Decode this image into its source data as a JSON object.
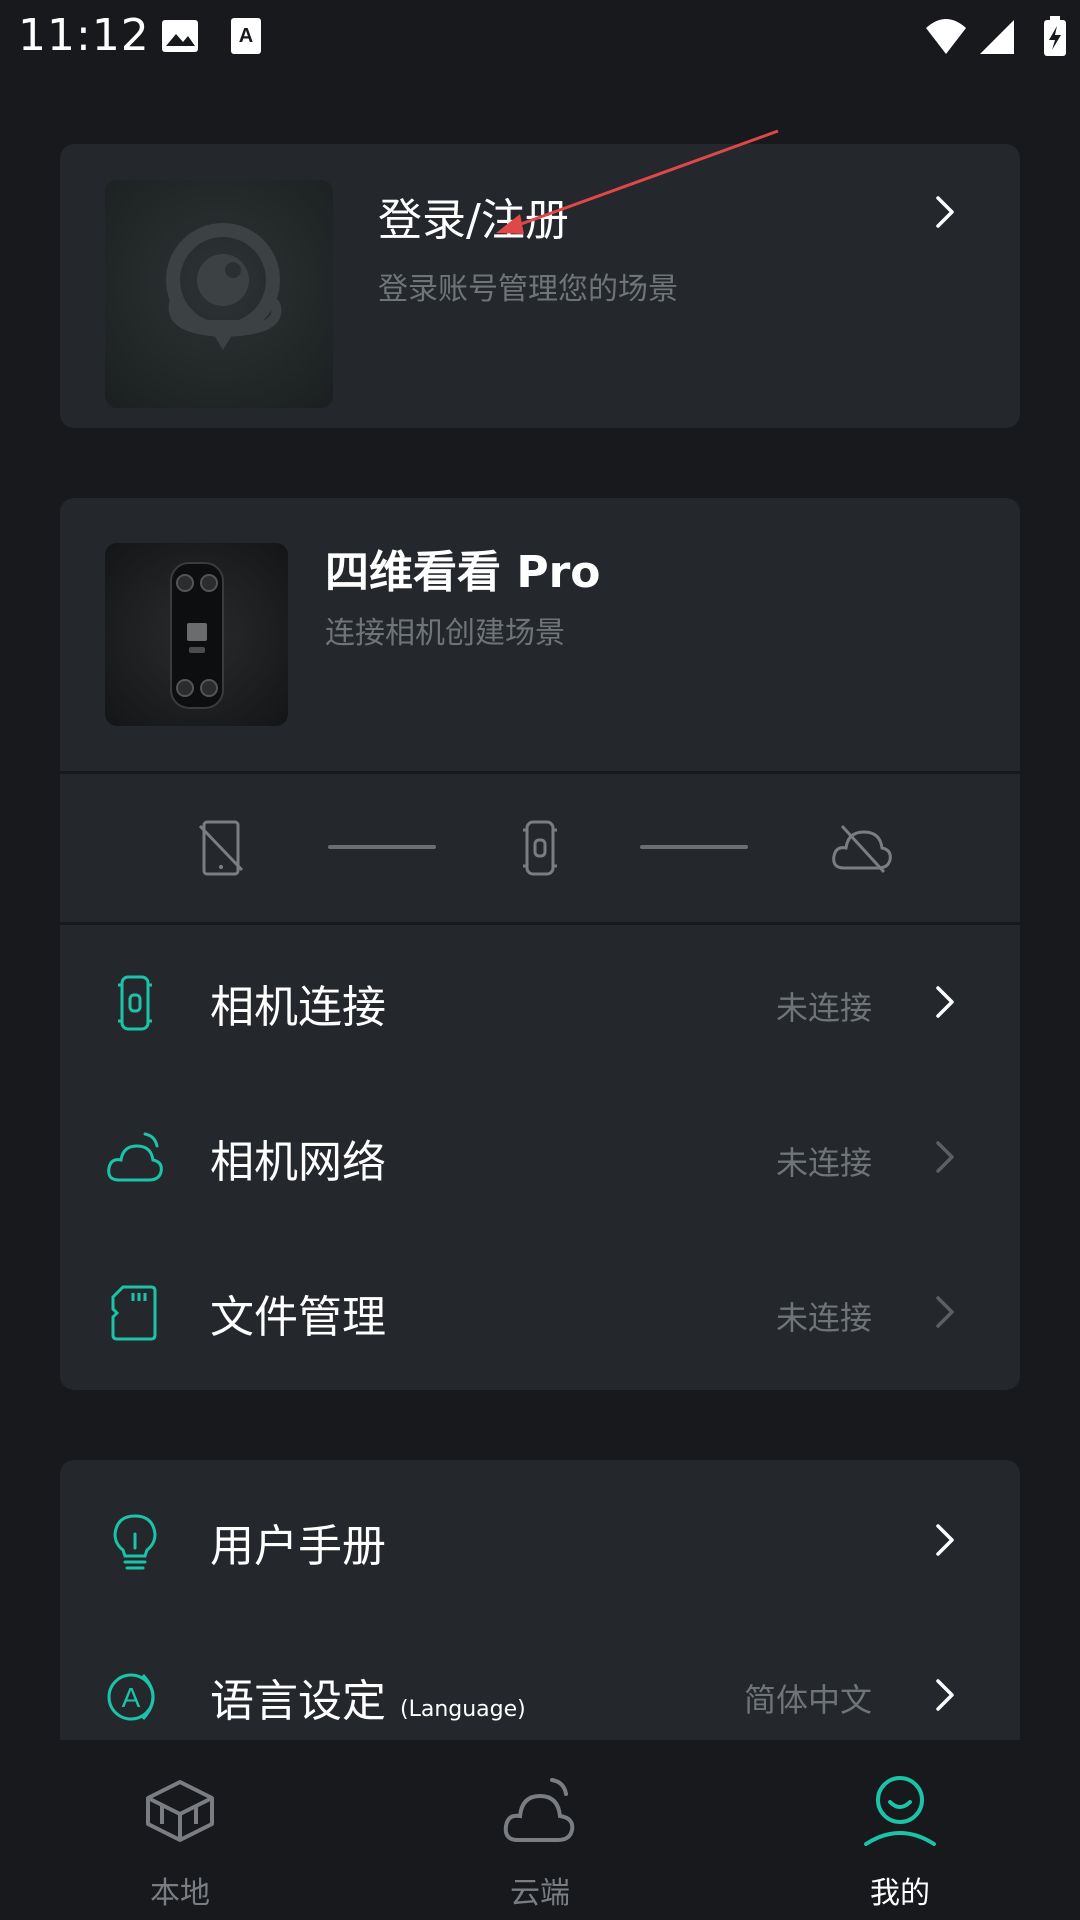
{
  "status_bar": {
    "time": "11:12"
  },
  "login": {
    "title": "登录/注册",
    "subtitle": "登录账号管理您的场景"
  },
  "device": {
    "title": "四维看看 Pro",
    "subtitle": "连接相机创建场景"
  },
  "device_rows": [
    {
      "label": "相机连接",
      "status": "未连接",
      "icon": "camera-device-icon"
    },
    {
      "label": "相机网络",
      "status": "未连接",
      "icon": "cloud-wifi-icon"
    },
    {
      "label": "文件管理",
      "status": "未连接",
      "icon": "sd-card-icon"
    }
  ],
  "help_rows": [
    {
      "label": "用户手册",
      "status": "",
      "icon": "lightbulb-icon"
    },
    {
      "label": "语言设定",
      "label_suffix": "(Language)",
      "status": "简体中文",
      "icon": "language-icon"
    }
  ],
  "bottom_nav": [
    {
      "label": "本地",
      "icon": "box-icon",
      "active": false
    },
    {
      "label": "云端",
      "icon": "cloud-icon",
      "active": false
    },
    {
      "label": "我的",
      "icon": "user-icon",
      "active": true
    }
  ],
  "colors": {
    "accent": "#1bc4a8",
    "background": "#17191c",
    "card": "#24272b",
    "muted_text": "#6f7478",
    "annotation": "#e04848"
  }
}
